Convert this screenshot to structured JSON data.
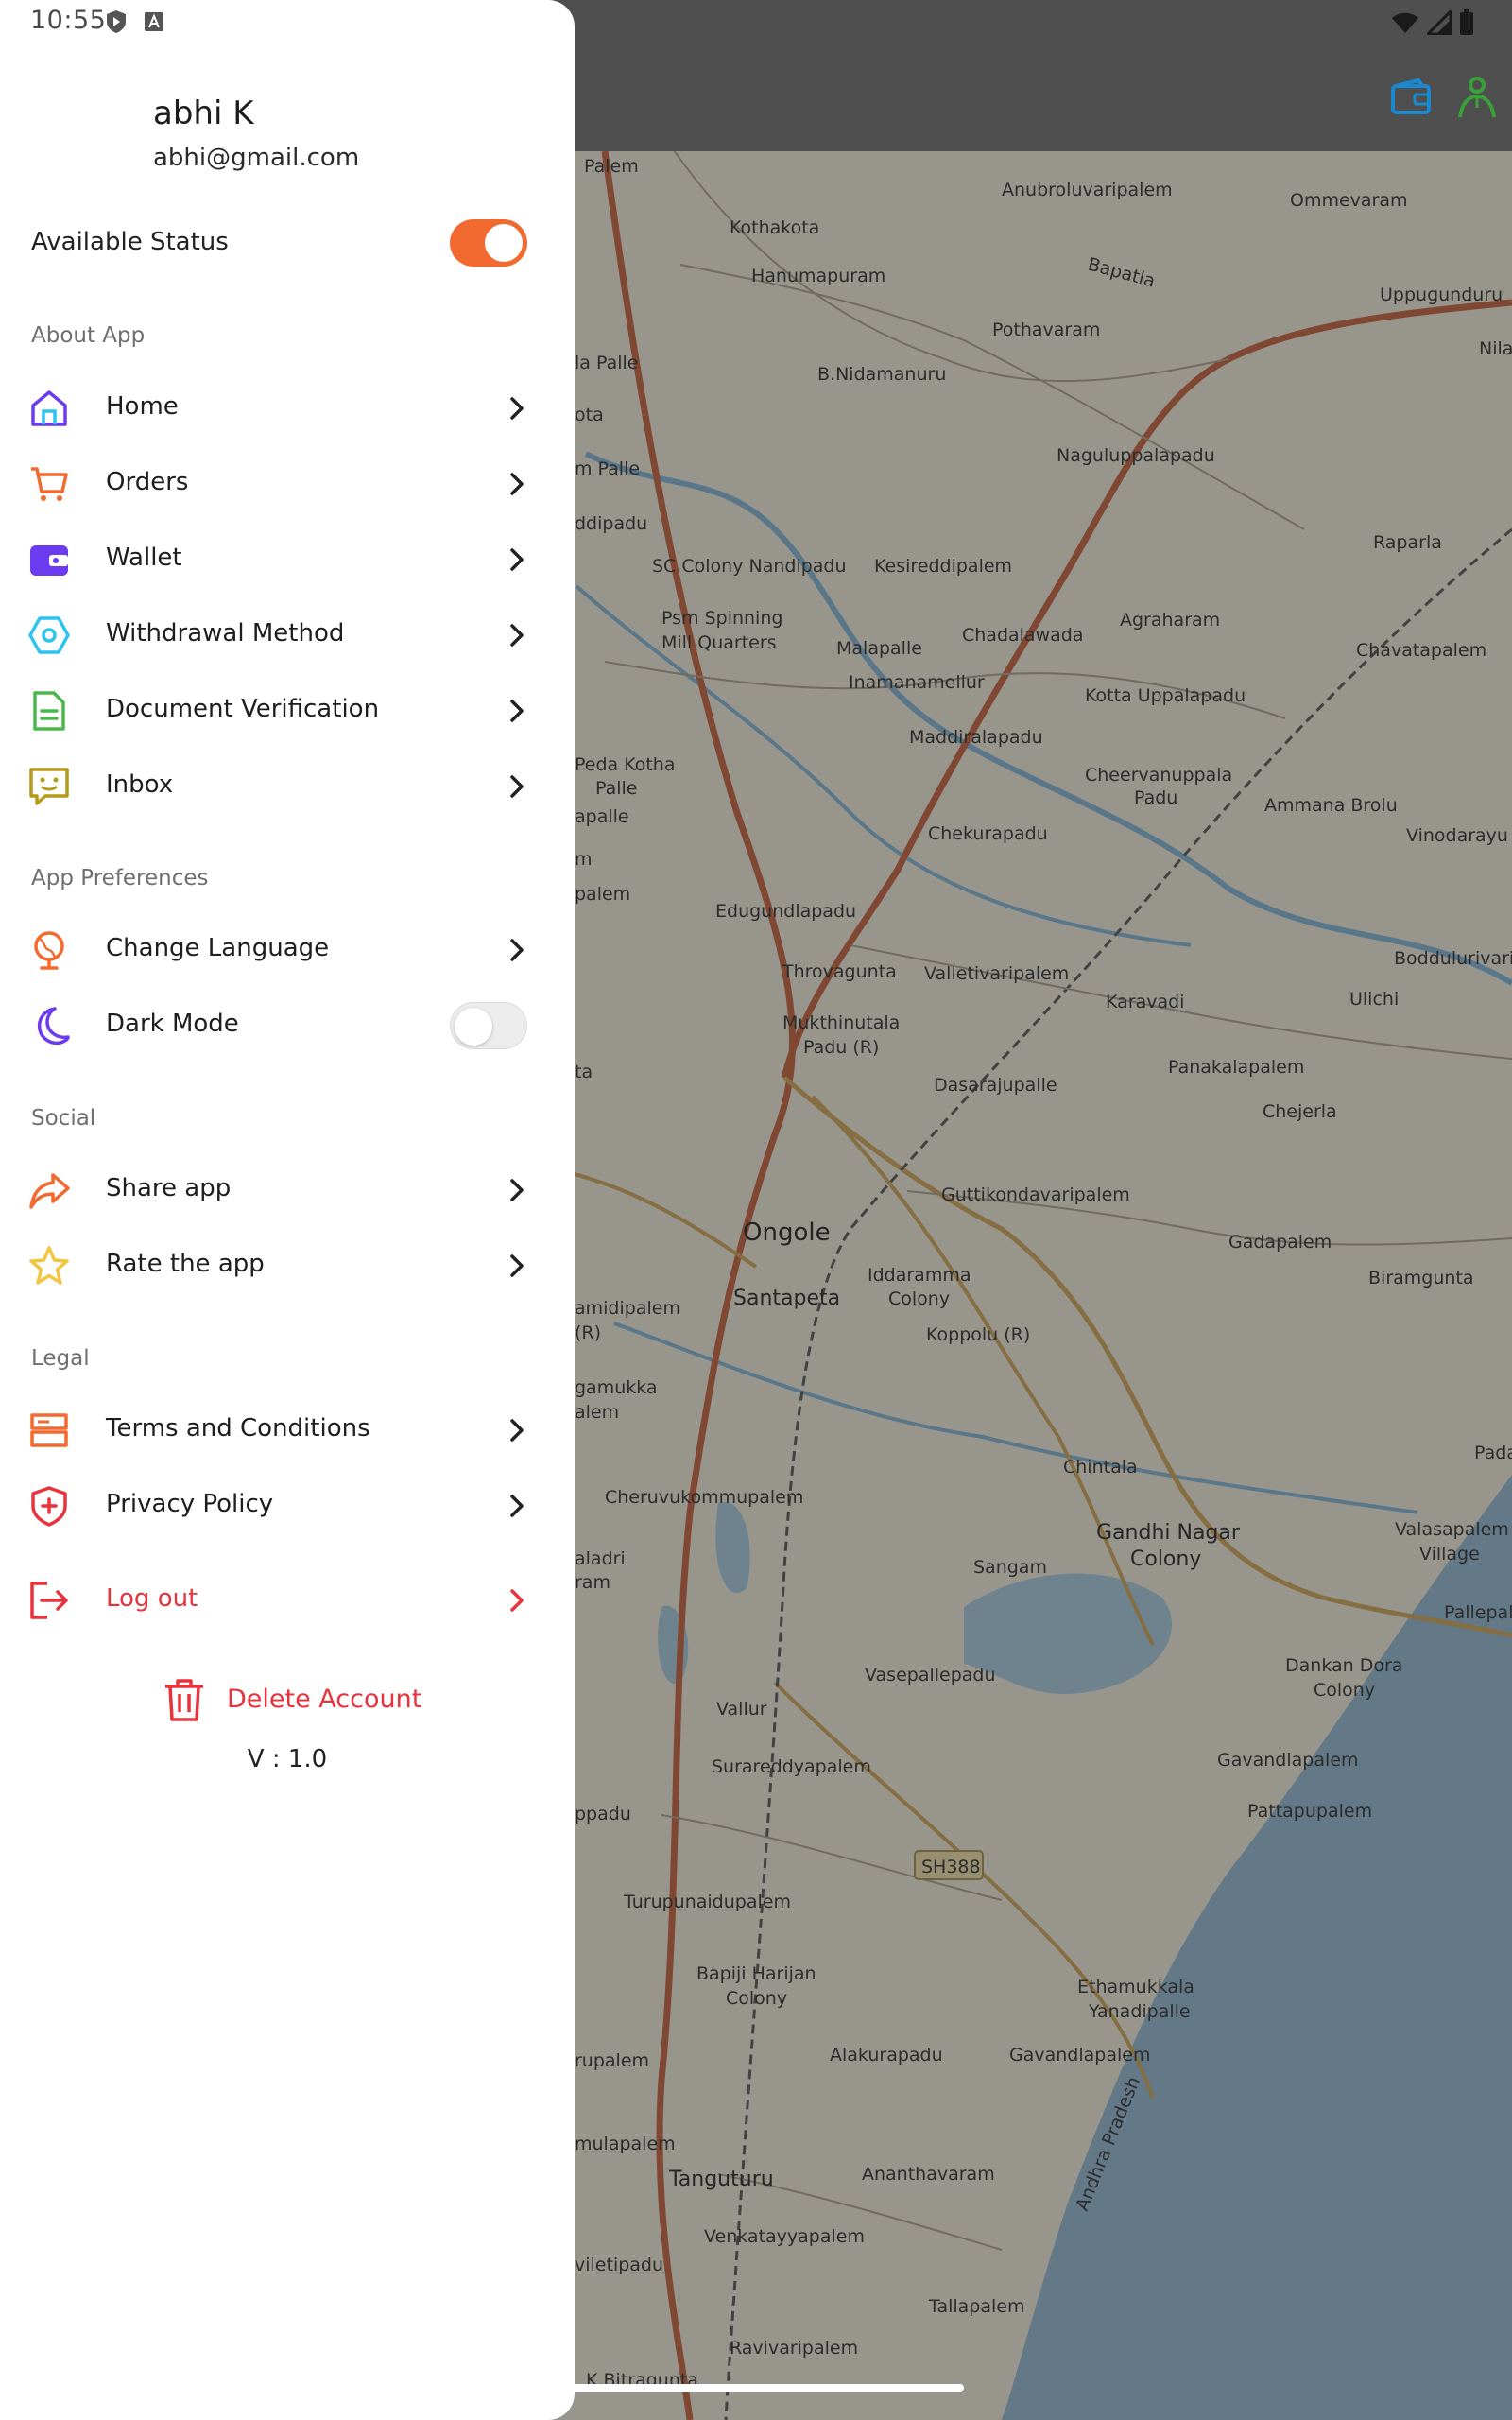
{
  "status_bar": {
    "time": "10:55",
    "left_icons": [
      "play-protect-icon",
      "keyboard-a-icon"
    ],
    "right_icons": [
      "wifi-icon",
      "cell-signal-icon",
      "battery-icon"
    ]
  },
  "profile": {
    "name": "abhi K",
    "email": "abhi@gmail.com"
  },
  "available_status": {
    "label": "Available Status",
    "enabled": true
  },
  "sections": {
    "about_app": "About App",
    "app_preferences": "App Preferences",
    "social": "Social",
    "legal": "Legal"
  },
  "menu": {
    "home": "Home",
    "orders": "Orders",
    "wallet": "Wallet",
    "withdrawal_method": "Withdrawal Method",
    "document_verification": "Document Verification",
    "inbox": "Inbox",
    "change_language": "Change Language",
    "dark_mode": "Dark Mode",
    "share_app": "Share app",
    "rate_app": "Rate the app",
    "terms": "Terms and Conditions",
    "privacy": "Privacy Policy",
    "logout": "Log out"
  },
  "dark_mode_enabled": false,
  "delete_account": "Delete Account",
  "version": "V : 1.0",
  "colors": {
    "accent_orange": "#f26a2f",
    "danger_red": "#e8323c",
    "icon_purple": "#6c3bf0",
    "icon_cyan": "#2ec4f0",
    "icon_green": "#4bb84b",
    "icon_olive": "#b59a1c",
    "icon_yellow": "#f5c542"
  },
  "map": {
    "labels": [
      "Palem",
      "Kothakota",
      "Anubroluvaripalem",
      "Ommevaram",
      "Bapatla",
      "Hanumapuram",
      "Uppugunduru",
      "Pothavaram",
      "la Palle",
      "B.Nidamanuru",
      "Nila",
      "ota",
      "Naguluppalapadu",
      "m Palle",
      "ddipadu",
      "Raparla",
      "SC Colony Nandipadu",
      "Kesireddipalem",
      "Psm Spinning",
      "Mill Quarters",
      "Malapalle",
      "Chadalawada",
      "Agraharam",
      "Chavatapalem",
      "Inamanamellur",
      "Kotta Uppalapadu",
      "Maddiralapadu",
      "Peda Kotha",
      "Palle",
      "Cheervanuppala",
      "Padu",
      "Ammana Brolu",
      "apalle",
      "Chekurapadu",
      "Vinodarayu",
      "m",
      "palem",
      "Edugundlapadu",
      "Throvagunta",
      "Valletivaripalem",
      "Boddulurivari",
      "Karavadi",
      "Ulichi",
      "Mukthinutala",
      "Padu (R)",
      "Panakalapalem",
      "ta",
      "Dasarajupalle",
      "Chejerla",
      "Guttikondavaripalem",
      "Ongole",
      "Gadapalem",
      "Iddaramma",
      "Colony",
      "Biramgunta",
      "Santapeta",
      "amidipalem",
      "(R)",
      "Koppolu (R)",
      "gamukka",
      "alem",
      "Chintala",
      "Pada",
      "Cheruvukommupalem",
      "Gandhi Nagar",
      "Colony",
      "Valasapalem",
      "Village",
      "aladri",
      "ram",
      "Sangam",
      "Pallepal",
      "Vasepallepadu",
      "Dankan Dora",
      "Colony",
      "Vallur",
      "Surareddyapalem",
      "Gavandlapalem",
      "ppadu",
      "Pattapupalem",
      "SH388",
      "Turupunaidupalem",
      "Ethamukkala",
      "Yanadipalle",
      "Bapiji Harijan",
      "Colony",
      "rupalem",
      "Alakurapadu",
      "Gavandlapalem",
      "Andhra Pradesh",
      "mulapalem",
      "Ananthavaram",
      "Tanguturu",
      "Venkatayyapalem",
      "viletipadu",
      "Tallapalem",
      "Ravivaripalem",
      "K.Bitragunta"
    ]
  }
}
